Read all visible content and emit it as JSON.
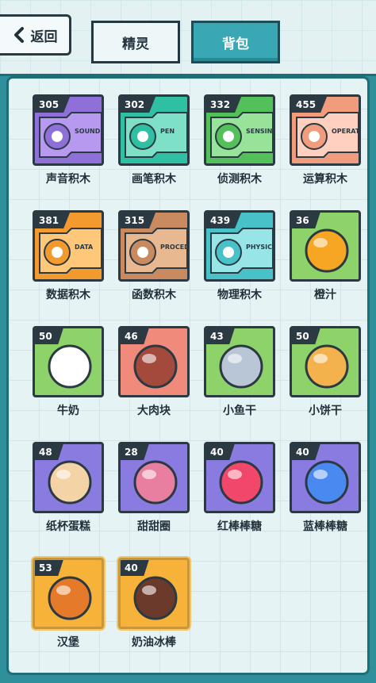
{
  "header": {
    "back_label": "返回",
    "tabs": [
      {
        "label": "精灵",
        "active": false
      },
      {
        "label": "背包",
        "active": true
      }
    ]
  },
  "items": [
    {
      "name": "声音积木",
      "count": "305",
      "bg": "#8f6fd8",
      "accent": "#b79af0",
      "icon": "microphone-icon",
      "tag": "SOUND"
    },
    {
      "name": "画笔积木",
      "count": "302",
      "bg": "#2fbfa3",
      "accent": "#7fe0c8",
      "icon": "pen-icon",
      "tag": "PEN"
    },
    {
      "name": "侦测积木",
      "count": "332",
      "bg": "#54c05a",
      "accent": "#98e39a",
      "icon": "sensing-icon",
      "tag": "SENSING"
    },
    {
      "name": "运算积木",
      "count": "455",
      "bg": "#f29c7e",
      "accent": "#ffd0bf",
      "icon": "operator-icon",
      "tag": "OPERATO"
    },
    {
      "name": "数据积木",
      "count": "381",
      "bg": "#f39a2e",
      "accent": "#ffc77a",
      "icon": "data-icon",
      "tag": "DATA"
    },
    {
      "name": "函数积木",
      "count": "315",
      "bg": "#c98a5f",
      "accent": "#e8b890",
      "icon": "procedure-icon",
      "tag": "PROCED"
    },
    {
      "name": "物理积木",
      "count": "439",
      "bg": "#48c2c8",
      "accent": "#98e5e8",
      "icon": "physics-icon",
      "tag": "PHYSICS"
    },
    {
      "name": "橙汁",
      "count": "36",
      "bg": "#8ed36a",
      "accent": "#f6a623",
      "icon": "orange-juice-icon",
      "tag": ""
    },
    {
      "name": "牛奶",
      "count": "50",
      "bg": "#8ed36a",
      "accent": "#ffffff",
      "icon": "milk-carton-icon",
      "tag": ""
    },
    {
      "name": "大肉块",
      "count": "46",
      "bg": "#f08a7a",
      "accent": "#a44a3c",
      "icon": "meat-icon",
      "tag": ""
    },
    {
      "name": "小鱼干",
      "count": "43",
      "bg": "#8ed36a",
      "accent": "#b9c6d6",
      "icon": "dried-fish-icon",
      "tag": ""
    },
    {
      "name": "小饼干",
      "count": "50",
      "bg": "#8ed36a",
      "accent": "#f3b24b",
      "icon": "cookie-icon",
      "tag": ""
    },
    {
      "name": "纸杯蛋糕",
      "count": "48",
      "bg": "#8a7be0",
      "accent": "#f4d3a6",
      "icon": "cupcake-icon",
      "tag": ""
    },
    {
      "name": "甜甜圈",
      "count": "28",
      "bg": "#8a7be0",
      "accent": "#e97fa0",
      "icon": "donut-icon",
      "tag": ""
    },
    {
      "name": "红棒棒糖",
      "count": "40",
      "bg": "#8a7be0",
      "accent": "#f0476a",
      "icon": "red-lollipop-icon",
      "tag": ""
    },
    {
      "name": "蓝棒棒糖",
      "count": "40",
      "bg": "#8a7be0",
      "accent": "#4a8af0",
      "icon": "blue-lollipop-icon",
      "tag": ""
    },
    {
      "name": "汉堡",
      "count": "53",
      "bg": "#f7b23a",
      "accent": "#e57a2a",
      "icon": "burger-icon",
      "tag": "",
      "gold": true
    },
    {
      "name": "奶油冰棒",
      "count": "40",
      "bg": "#f7b23a",
      "accent": "#6b3a2a",
      "icon": "ice-cream-bar-icon",
      "tag": "",
      "gold": true
    }
  ]
}
